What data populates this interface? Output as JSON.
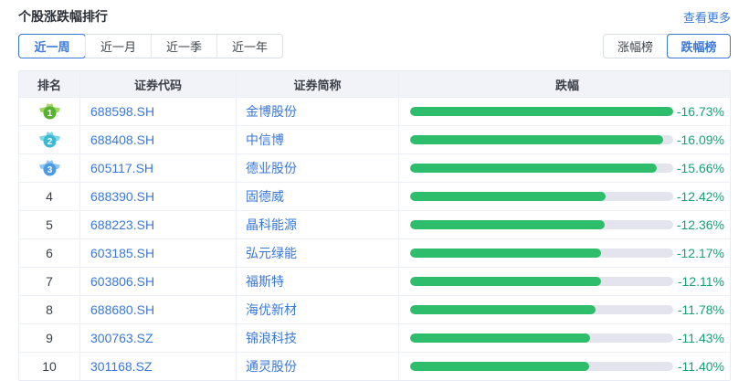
{
  "header": {
    "title": "个股涨跌幅排行",
    "more_label": "查看更多"
  },
  "period_tabs": {
    "items": [
      "近一周",
      "近一月",
      "近一季",
      "近一年"
    ],
    "selected": "近一周"
  },
  "board_toggle": {
    "items": [
      "涨幅榜",
      "跌幅榜"
    ],
    "selected": "跌幅榜"
  },
  "table": {
    "columns": [
      "排名",
      "证券代码",
      "证券简称",
      "跌幅"
    ],
    "max_abs_change": 16.73,
    "rows": [
      {
        "rank": "1",
        "code": "688598.SH",
        "name": "金博股份",
        "change": "-16.73%",
        "value": -16.73
      },
      {
        "rank": "2",
        "code": "688408.SH",
        "name": "中信博",
        "change": "-16.09%",
        "value": -16.09
      },
      {
        "rank": "3",
        "code": "605117.SH",
        "name": "德业股份",
        "change": "-15.66%",
        "value": -15.66
      },
      {
        "rank": "4",
        "code": "688390.SH",
        "name": "固德威",
        "change": "-12.42%",
        "value": -12.42
      },
      {
        "rank": "5",
        "code": "688223.SH",
        "name": "晶科能源",
        "change": "-12.36%",
        "value": -12.36
      },
      {
        "rank": "6",
        "code": "603185.SH",
        "name": "弘元绿能",
        "change": "-12.17%",
        "value": -12.17
      },
      {
        "rank": "7",
        "code": "603806.SH",
        "name": "福斯特",
        "change": "-12.11%",
        "value": -12.11
      },
      {
        "rank": "8",
        "code": "688680.SH",
        "name": "海优新材",
        "change": "-11.78%",
        "value": -11.78
      },
      {
        "rank": "9",
        "code": "300763.SZ",
        "name": "锦浪科技",
        "change": "-11.43%",
        "value": -11.43
      },
      {
        "rank": "10",
        "code": "301168.SZ",
        "name": "通灵股份",
        "change": "-11.40%",
        "value": -11.4
      }
    ]
  },
  "colors": {
    "accent_blue": "#3b78d8",
    "bar_green": "#2ebd6b",
    "bar_track": "#e4e4ef",
    "pct_green": "#18a077",
    "medals": [
      {
        "wing": "#a6d464",
        "circle": "#55b232"
      },
      {
        "wing": "#7fd6e6",
        "circle": "#3cb9d3"
      },
      {
        "wing": "#93c6f4",
        "circle": "#4a9be4"
      }
    ]
  }
}
